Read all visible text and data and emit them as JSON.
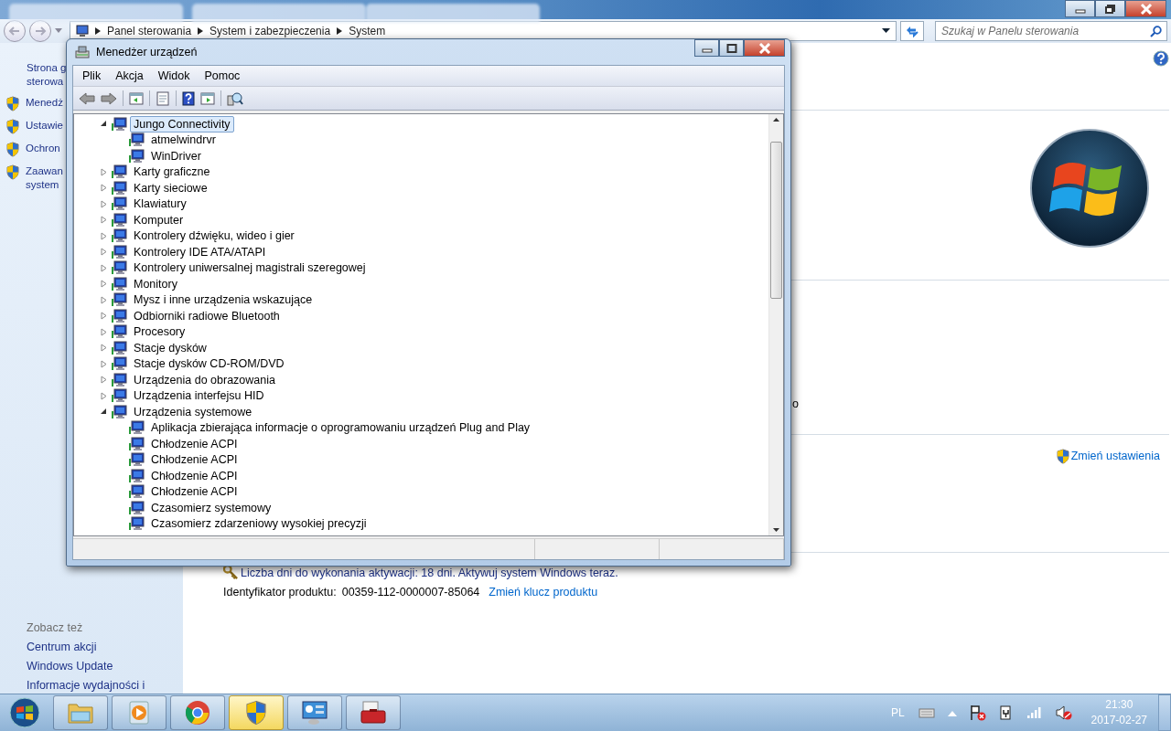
{
  "address_bar": {
    "breadcrumb": [
      "Panel sterowania",
      "System i zabezpieczenia",
      "System"
    ],
    "search": {
      "placeholder": "Szukaj w Panelu sterowania"
    }
  },
  "sidebar": {
    "links": [
      {
        "lines": [
          "Strona g",
          "sterowa"
        ],
        "shield": false
      },
      {
        "lines": [
          "Menedż"
        ],
        "shield": true
      },
      {
        "lines": [
          "Ustawie"
        ],
        "shield": true
      },
      {
        "lines": [
          "Ochron"
        ],
        "shield": true
      },
      {
        "lines": [
          "Zaawan",
          "system"
        ],
        "shield": true
      }
    ],
    "see_also": {
      "title": "Zobacz też",
      "links": [
        "Centrum akcji",
        "Windows Update",
        "Informacje wydajności i"
      ]
    }
  },
  "main": {
    "fragment": "o",
    "change_settings": "Zmień ustawienia",
    "activation": "Liczba dni do wykonania aktywacji: 18 dni. Aktywuj system Windows teraz.",
    "product_id_label": "Identyfikator produktu:",
    "product_id": "00359-112-0000007-85064",
    "change_key": "Zmień klucz produktu"
  },
  "device_manager": {
    "title": "Menedżer urządzeń",
    "menu": [
      "Plik",
      "Akcja",
      "Widok",
      "Pomoc"
    ],
    "tree": [
      {
        "label": "Jungo Connectivity",
        "expanded": true,
        "selected": true,
        "children": [
          {
            "label": "atmelwindrvr",
            "selected": false
          },
          {
            "label": "WinDriver",
            "selected": false
          }
        ]
      },
      {
        "label": "Karty graficzne",
        "expanded": false,
        "selected": false
      },
      {
        "label": "Karty sieciowe",
        "expanded": false,
        "selected": false
      },
      {
        "label": "Klawiatury",
        "expanded": false,
        "selected": false
      },
      {
        "label": "Komputer",
        "expanded": false,
        "selected": false
      },
      {
        "label": "Kontrolery dźwięku, wideo i gier",
        "expanded": false,
        "selected": false
      },
      {
        "label": "Kontrolery IDE ATA/ATAPI",
        "expanded": false,
        "selected": false
      },
      {
        "label": "Kontrolery uniwersalnej magistrali szeregowej",
        "expanded": false,
        "selected": false
      },
      {
        "label": "Monitory",
        "expanded": false,
        "selected": false
      },
      {
        "label": "Mysz i inne urządzenia wskazujące",
        "expanded": false,
        "selected": false
      },
      {
        "label": "Odbiorniki radiowe Bluetooth",
        "expanded": false,
        "selected": false
      },
      {
        "label": "Procesory",
        "expanded": false,
        "selected": false
      },
      {
        "label": "Stacje dysków",
        "expanded": false,
        "selected": false
      },
      {
        "label": "Stacje dysków CD-ROM/DVD",
        "expanded": false,
        "selected": false
      },
      {
        "label": "Urządzenia do obrazowania",
        "expanded": false,
        "selected": false
      },
      {
        "label": "Urządzenia interfejsu HID",
        "expanded": false,
        "selected": false
      },
      {
        "label": "Urządzenia systemowe",
        "expanded": true,
        "selected": false,
        "children": [
          {
            "label": "Aplikacja zbierająca informacje o oprogramowaniu urządzeń Plug and Play",
            "selected": false
          },
          {
            "label": "Chłodzenie ACPI",
            "selected": false
          },
          {
            "label": "Chłodzenie ACPI",
            "selected": false
          },
          {
            "label": "Chłodzenie ACPI",
            "selected": false
          },
          {
            "label": "Chłodzenie ACPI",
            "selected": false
          },
          {
            "label": "Czasomierz systemowy",
            "selected": false
          },
          {
            "label": "Czasomierz zdarzeniowy wysokiej precyzji",
            "selected": false
          }
        ]
      }
    ]
  },
  "taskbar": {
    "apps": [
      {
        "kind": "folder",
        "selected": false
      },
      {
        "kind": "player",
        "selected": false
      },
      {
        "kind": "browser",
        "selected": false
      },
      {
        "kind": "shield",
        "selected": true
      },
      {
        "kind": "panel",
        "selected": false
      },
      {
        "kind": "toolbox",
        "selected": false
      }
    ],
    "tray": {
      "language": "PL",
      "time": "21:30",
      "date": "2017-02-27"
    }
  }
}
